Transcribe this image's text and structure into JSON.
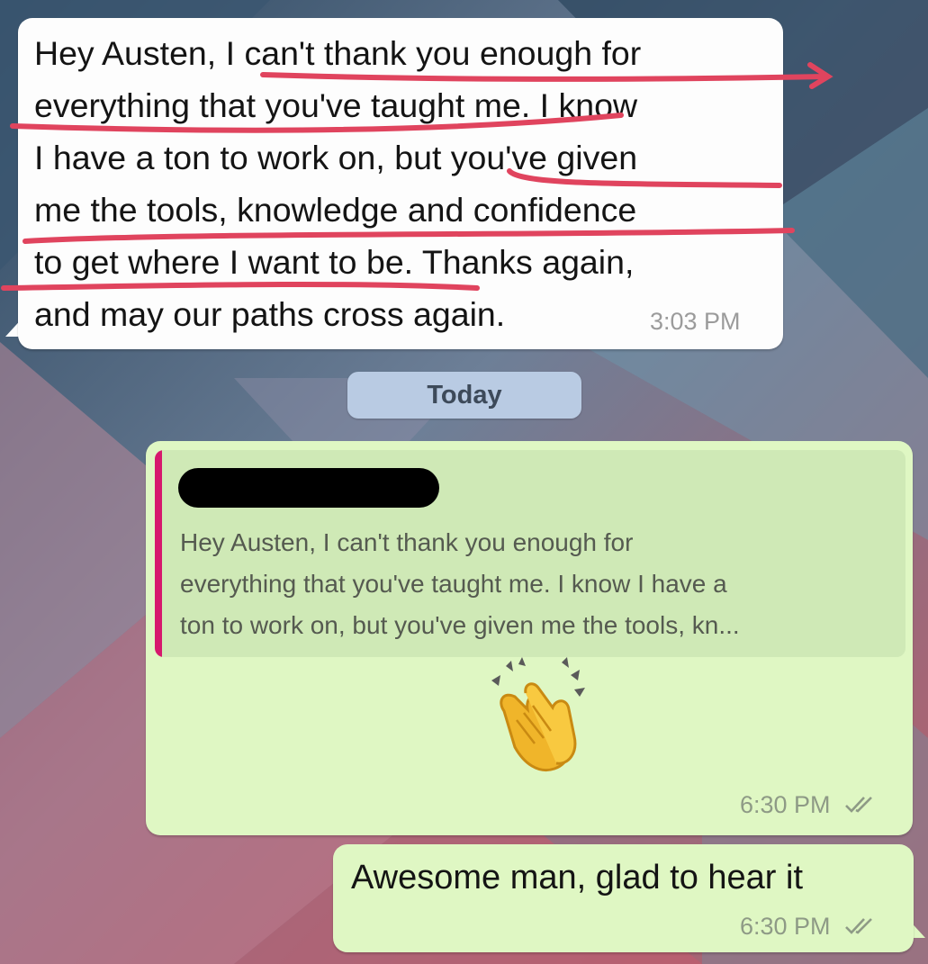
{
  "conversation": {
    "incoming_message": {
      "text": "Hey Austen, I can't thank you enough for\neverything that you've taught me. I know\nI have a ton to work on, but you've given\nme the tools, knowledge and confidence\nto get where I want to be. Thanks again,\nand may our paths cross again.",
      "time": "3:03 PM"
    },
    "date_divider": "Today",
    "reply_message": {
      "quoted_text": "Hey Austen, I can't thank you enough for\neverything that you've taught me. I know I have a\nton to work on, but you've given me the tools, kn...",
      "emoji": "clapping-hands",
      "time": "6:30 PM",
      "status": "read-double-check"
    },
    "second_reply": {
      "text": "Awesome man, glad to hear it",
      "time": "6:30 PM",
      "status": "read-double-check"
    }
  },
  "colors": {
    "incoming_bubble": "#fdfdfd",
    "outgoing_bubble": "#dff7c3",
    "quote_bar": "#d6186d",
    "highlight_underline": "#e0445e",
    "date_pill": "#b9cbe3"
  },
  "icons": {
    "read_receipt": "double-check-icon",
    "redaction": "redacted-name-blot"
  }
}
